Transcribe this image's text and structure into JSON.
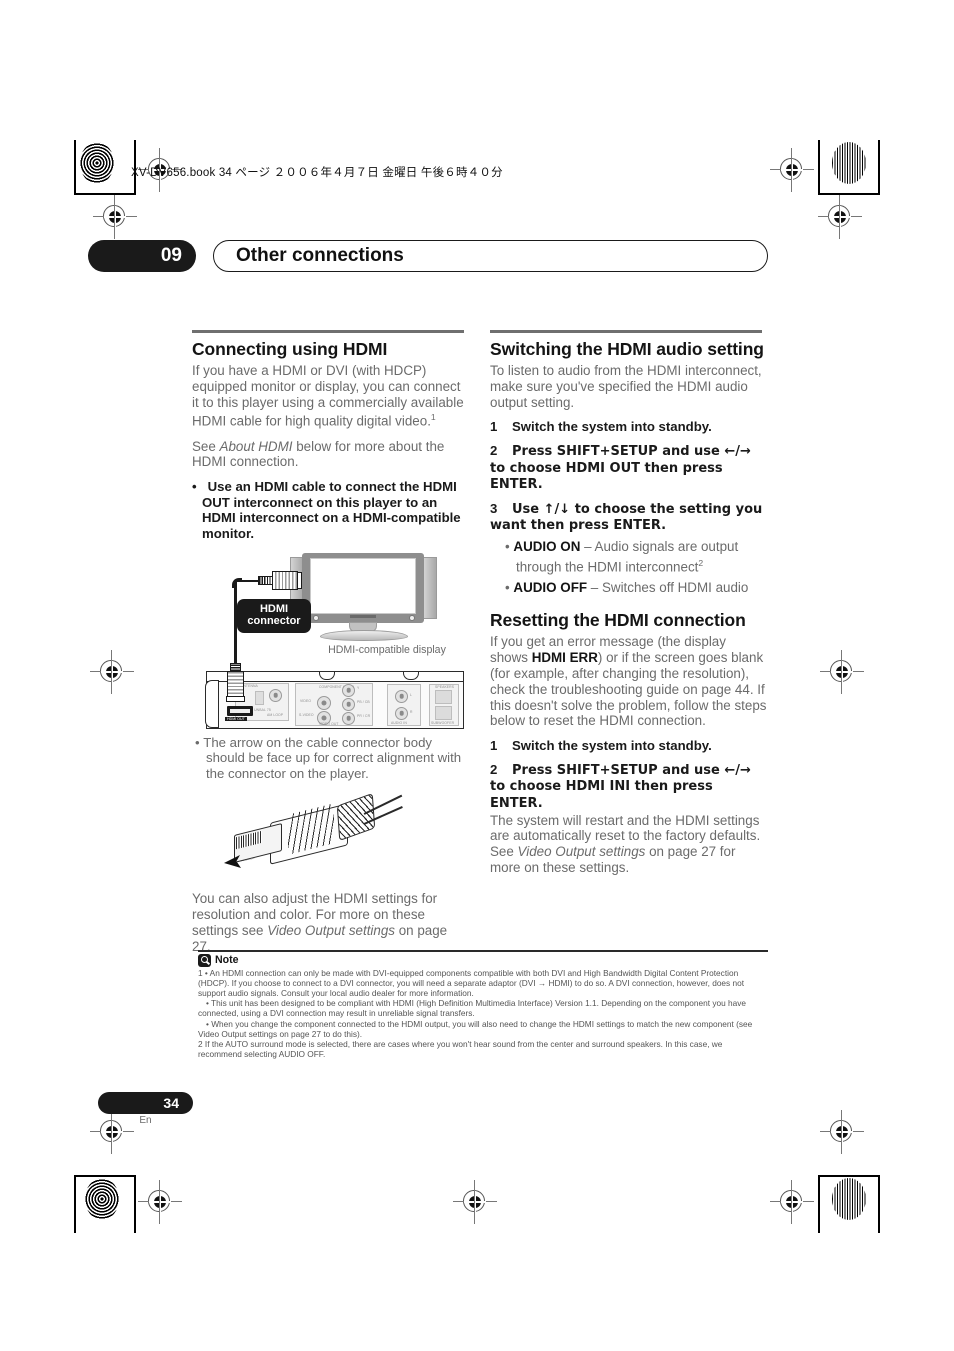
{
  "print_header": {
    "file_line": "XV-DV656.book  34 ページ  ２００６年４月７日   金曜日   午後６時４０分"
  },
  "chapter": {
    "number": "09",
    "title": "Other connections"
  },
  "left_column": {
    "heading": "Connecting using HDMI",
    "intro": "If you have a HDMI or DVI (with HDCP) equipped monitor or display, you can connect it to this player using a commercially available HDMI cable for high quality digital video.",
    "intro_footnote": "1",
    "see_text_pre": "See ",
    "see_text_italic": "About HDMI",
    "see_text_post": " below for more about the HDMI connection.",
    "bullet_instruction": "Use an HDMI cable to connect the HDMI OUT interconnect on this player to an HDMI interconnect on a HDMI-compatible monitor.",
    "diagram": {
      "connector_label_line1": "HDMI",
      "connector_label_line2": "connector",
      "display_caption": "HDMI-compatible display",
      "panel_labels": {
        "antenna": "ANTENNA",
        "fm_unbal": "FM UNBAL 75",
        "am_loop": "AM LOOP",
        "component": "COMPONENT VIDEO",
        "video": "VIDEO",
        "s_video": "S-VIDEO",
        "y": "Y",
        "pb": "PB / CB",
        "pr": "PR / CR",
        "video_out": "VIDEO OUT",
        "audio_in": "AUDIO IN",
        "audio_l": "L",
        "audio_r": "R",
        "hdmi_out": "HDMI OUT",
        "speakers": "SPEAKERS",
        "subwoofer": "SUBWOOFER"
      }
    },
    "arrow_note": "The arrow on the cable connector body should be face up for correct alignment with the connector on the player.",
    "closing_pre": "You can also adjust the HDMI settings for resolution and color. For more on these settings see ",
    "closing_italic": "Video Output settings",
    "closing_post": " on page 27."
  },
  "right_column": {
    "section1": {
      "heading": "Switching the HDMI audio setting",
      "intro": "To listen to audio from the HDMI interconnect, make sure you've specified the HDMI audio output setting.",
      "steps": [
        {
          "num": "1",
          "text": "Switch the system into standby."
        },
        {
          "num": "2",
          "text": "Press SHIFT+SETUP and use ←/→ to choose HDMI OUT then press ENTER."
        },
        {
          "num": "3",
          "text": "Use ↑/↓ to choose the setting you want then press ENTER."
        }
      ],
      "options": [
        {
          "label": "AUDIO ON",
          "desc": " – Audio signals are output through the HDMI interconnect",
          "footnote": "2"
        },
        {
          "label": "AUDIO OFF",
          "desc": " – Switches off HDMI audio",
          "footnote": ""
        }
      ]
    },
    "section2": {
      "heading": "Resetting the HDMI connection",
      "intro_pre": "If you get an error message (the display shows ",
      "intro_bold": "HDMI ERR",
      "intro_post": ") or if the screen goes blank (for example, after changing the resolution), check the troubleshooting guide on page 44. If this doesn't solve the problem, follow the steps below to reset the HDMI connection.",
      "steps": [
        {
          "num": "1",
          "text": "Switch the system into standby."
        },
        {
          "num": "2",
          "text": "Press SHIFT+SETUP and use ←/→ to choose HDMI INI then press ENTER."
        }
      ],
      "closing_pre": "The system will restart and the HDMI settings are automatically reset to the factory defaults. See ",
      "closing_italic": "Video Output settings",
      "closing_post": " on page 27 for more on these settings."
    }
  },
  "note": {
    "title": "Note",
    "items": [
      "1 • An HDMI connection can only be made with DVI-equipped components compatible with both DVI and High Bandwidth Digital Content Protection (HDCP). If you choose to connect to a DVI connector, you will need a separate adaptor (DVI → HDMI) to do so. A DVI connection, however, does not support audio signals. Consult your local audio dealer for more information.",
      "• This unit has been designed to be compliant with HDMI (High Definition Multimedia Interface) Version 1.1. Depending on the component you have connected, using a DVI connection may result in unreliable signal transfers.",
      "• When you change the component connected to the HDMI output, you will also need to change the HDMI settings to match the new component (see Video Output settings on page 27 to do this).",
      "2 If the AUTO surround mode is selected, there are cases where you won't hear sound from the center and surround speakers. In this case, we recommend selecting AUDIO OFF."
    ],
    "item3_italic": "Video Output settings",
    "item4_bold1": "AUTO",
    "item4_bold2": "AUDIO OFF"
  },
  "footer": {
    "page_number": "34",
    "language": "En"
  },
  "colors": {
    "ink": "#231f20",
    "body_gray": "#6b6b6b",
    "pill_black": "#1a1a1a"
  }
}
